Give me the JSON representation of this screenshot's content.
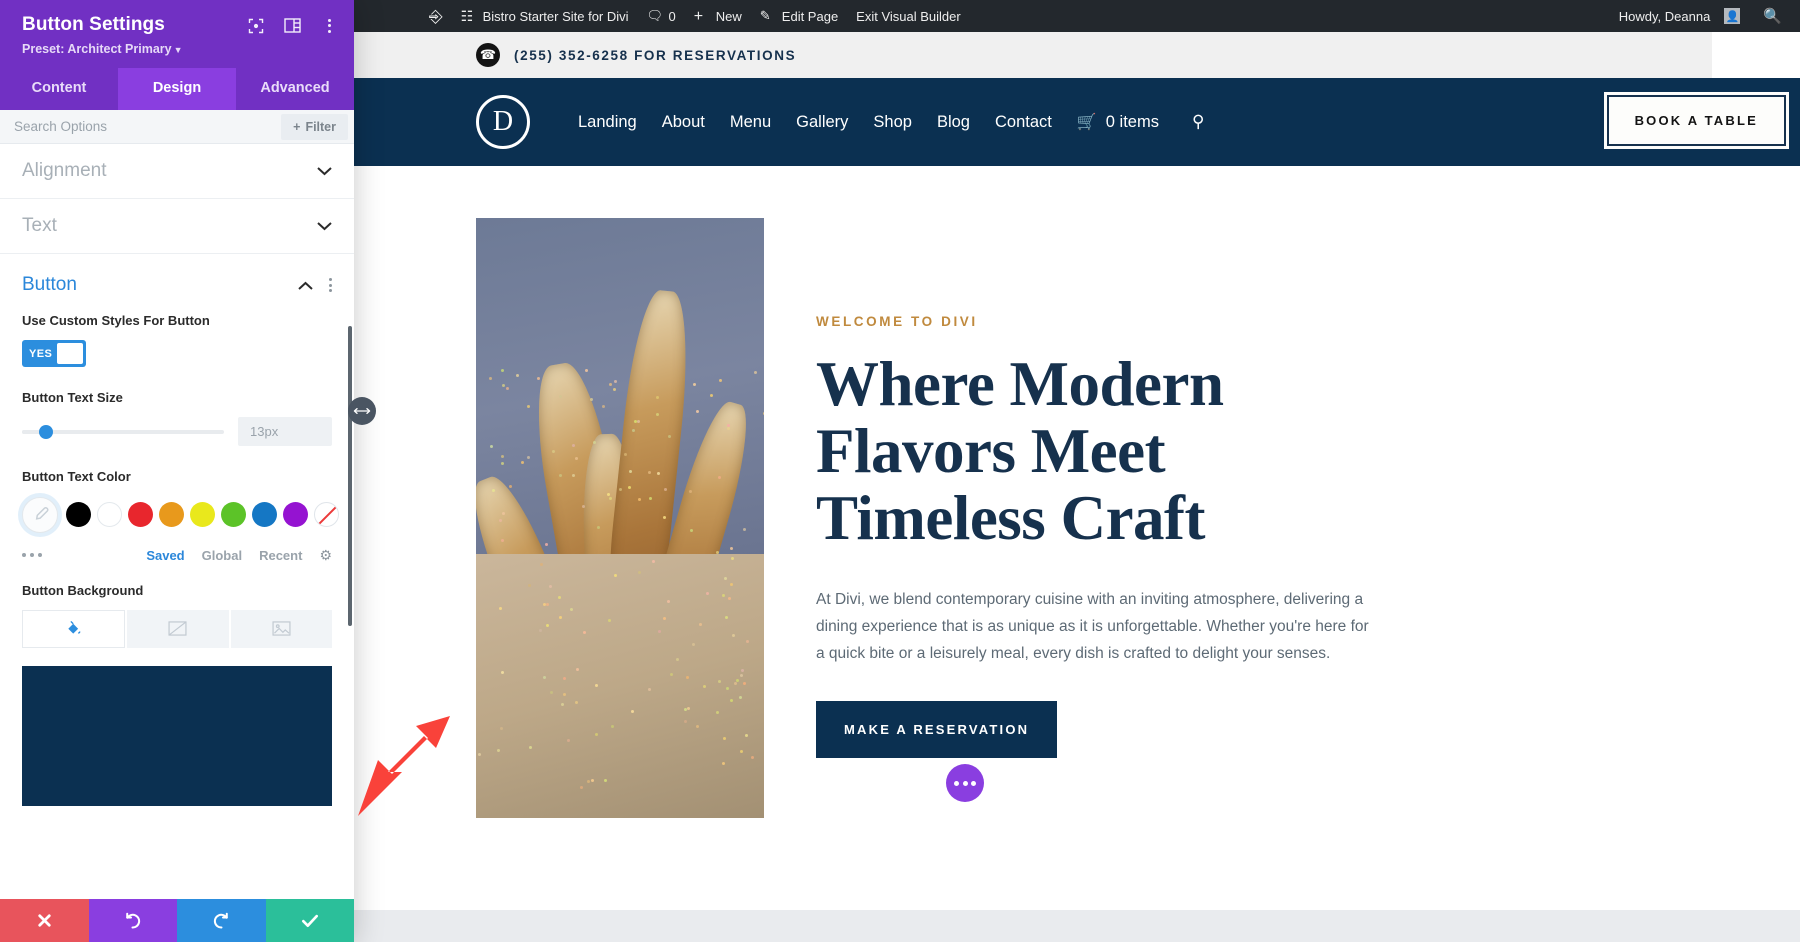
{
  "admin_bar": {
    "wp_logo": "wordpress-logo",
    "site_name": "Bistro Starter Site for Divi",
    "comment_count": "0",
    "new_label": "New",
    "edit_page_label": "Edit Page",
    "exit_builder_label": "Exit Visual Builder",
    "howdy": "Howdy, Deanna",
    "search_icon": "search-icon"
  },
  "panel": {
    "title": "Button Settings",
    "preset": "Preset: Architect Primary",
    "header_icons": [
      "focus-icon",
      "layout-icon",
      "more-vertical-icon"
    ],
    "tabs": [
      {
        "label": "Content",
        "active": false
      },
      {
        "label": "Design",
        "active": true
      },
      {
        "label": "Advanced",
        "active": false
      }
    ],
    "search_placeholder": "Search Options",
    "search_value": "",
    "filter_label": "Filter",
    "sections": [
      {
        "label": "Alignment",
        "open": false
      },
      {
        "label": "Text",
        "open": false
      },
      {
        "label": "Button",
        "open": true
      }
    ],
    "fields": {
      "custom_styles": {
        "label": "Use Custom Styles For Button",
        "toggle_value": "YES"
      },
      "text_size": {
        "label": "Button Text Size",
        "value": "13px"
      },
      "text_color": {
        "label": "Button Text Color",
        "swatches": [
          "#000000",
          "#ffffff",
          "#e8262d",
          "#e8991c",
          "#e9e81c",
          "#5cc328",
          "#1577c4",
          "#9513d1",
          "none"
        ],
        "tabs": [
          {
            "label": "Saved",
            "active": true
          },
          {
            "label": "Global",
            "active": false
          },
          {
            "label": "Recent",
            "active": false
          }
        ],
        "gear": "gear-icon"
      },
      "background": {
        "label": "Button Background",
        "tabs": [
          "fill-color-icon",
          "gradient-icon",
          "image-icon"
        ],
        "active_tab": 0,
        "preview_color": "#0b3051"
      }
    },
    "actions": [
      {
        "name": "cancel",
        "icon": "close-icon",
        "color": "#e8545c"
      },
      {
        "name": "undo",
        "icon": "undo-icon",
        "color": "#8a3ee0"
      },
      {
        "name": "redo",
        "icon": "redo-icon",
        "color": "#2c8ede"
      },
      {
        "name": "save",
        "icon": "check-icon",
        "color": "#2bbf9a"
      }
    ]
  },
  "site": {
    "phone": "(255) 352-6258 FOR RESERVATIONS",
    "logo": "D",
    "nav_links": [
      "Landing",
      "About",
      "Menu",
      "Gallery",
      "Shop",
      "Blog",
      "Contact"
    ],
    "cart_text": "0 items",
    "book_button": "BOOK A TABLE",
    "hero": {
      "eyebrow": "WELCOME TO DIVI",
      "heading": "Where Modern Flavors Meet Timeless Craft",
      "paragraph": "At Divi, we blend contemporary cuisine with an inviting atmosphere, delivering a dining experience that is as unique as it is unforgettable. Whether you're here for a quick bite or a leisurely meal, every dish is crafted to delight your senses.",
      "cta": "MAKE A RESERVATION"
    }
  },
  "colors": {
    "divi_purple": "#7130c3",
    "divi_purple_active": "#8a3ee0",
    "accent_blue": "#2c8ede",
    "navy": "#0b3051",
    "gold": "#c08a3e",
    "arrow_red": "#f9423a"
  }
}
